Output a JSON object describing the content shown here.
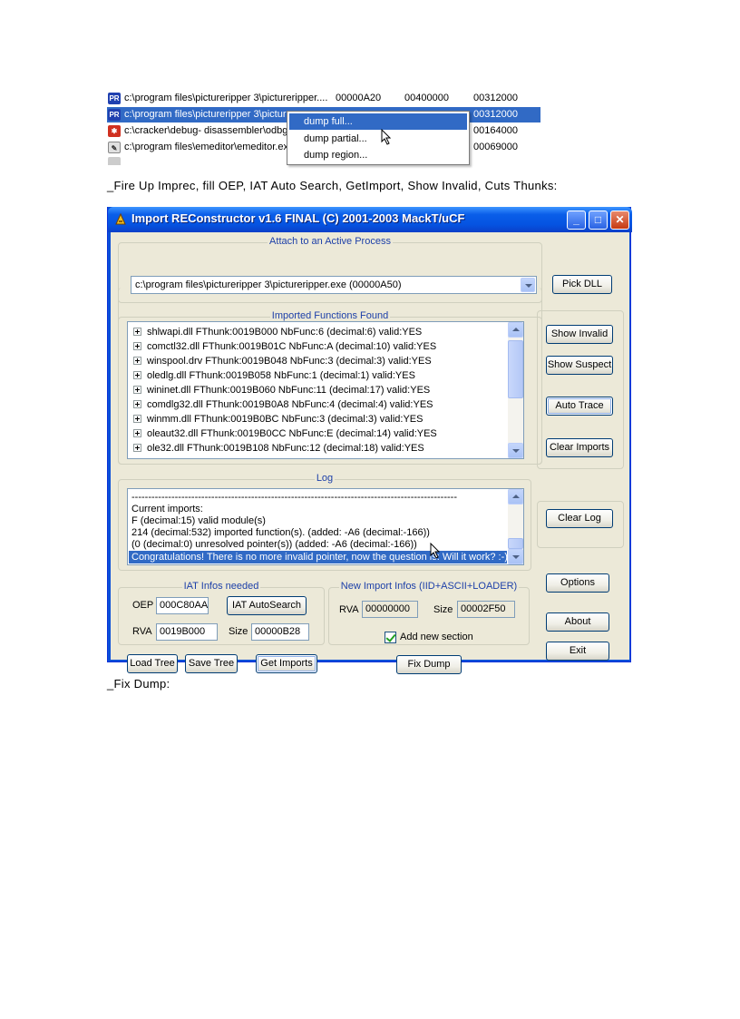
{
  "process_list": {
    "rows": [
      {
        "path": "c:\\program files\\pictureripper 3\\pictureripper....",
        "c1": "00000A20",
        "c2": "00400000",
        "c3": "00312000"
      },
      {
        "path": "c:\\program files\\pictureripper 3\\picture",
        "c1": "",
        "c2": "",
        "c3": "00312000"
      },
      {
        "path": "c:\\cracker\\debug- disassembler\\odbg",
        "c1": "",
        "c2": "",
        "c3": "00164000"
      },
      {
        "path": "c:\\program files\\emeditor\\emeditor.ex",
        "c1": "",
        "c2": "",
        "c3": "00069000"
      }
    ],
    "context_menu": [
      "dump full...",
      "dump partial...",
      "dump region..."
    ]
  },
  "caption_1": "_Fire Up Imprec, fill OEP, IAT Auto Search, GetImport, Show Invalid, Cuts Thunks:",
  "caption_2": "_Fix Dump:",
  "window": {
    "title": "Import REConstructor v1.6 FINAL (C) 2001-2003 MackT/uCF",
    "attach": {
      "group_title": "Attach to an Active Process",
      "process_value": "c:\\program files\\pictureripper 3\\pictureripper.exe (00000A50)",
      "pick_dll_label": "Pick DLL"
    },
    "imports": {
      "group_title": "Imported Functions Found",
      "items": [
        "shlwapi.dll FThunk:0019B000 NbFunc:6 (decimal:6) valid:YES",
        "comctl32.dll FThunk:0019B01C NbFunc:A (decimal:10) valid:YES",
        "winspool.drv FThunk:0019B048 NbFunc:3 (decimal:3) valid:YES",
        "oledlg.dll FThunk:0019B058 NbFunc:1 (decimal:1) valid:YES",
        "wininet.dll FThunk:0019B060 NbFunc:11 (decimal:17) valid:YES",
        "comdlg32.dll FThunk:0019B0A8 NbFunc:4 (decimal:4) valid:YES",
        "winmm.dll FThunk:0019B0BC NbFunc:3 (decimal:3) valid:YES",
        "oleaut32.dll FThunk:0019B0CC NbFunc:E (decimal:14) valid:YES",
        "ole32.dll FThunk:0019B108 NbFunc:12 (decimal:18) valid:YES"
      ]
    },
    "side_buttons": {
      "show_invalid": "Show Invalid",
      "show_suspect": "Show Suspect",
      "auto_trace": "Auto Trace",
      "clear_imports": "Clear Imports",
      "clear_log": "Clear Log",
      "options": "Options",
      "about": "About",
      "exit": "Exit"
    },
    "log": {
      "group_title": "Log",
      "lines": [
        "--------------------------------------------------------------------------------------------------",
        "Current imports:",
        "F (decimal:15) valid module(s)",
        "214 (decimal:532) imported function(s). (added: -A6 (decimal:-166))",
        "(0 (decimal:0) unresolved pointer(s)) (added: -A6 (decimal:-166))",
        "Congratulations! There is no more invalid pointer, now the question is: Will it work? :-)"
      ]
    },
    "iat": {
      "group_title": "IAT Infos needed",
      "oep_label": "OEP",
      "oep_value": "000C80AA",
      "autosearch_label": "IAT AutoSearch",
      "rva_label": "RVA",
      "rva_value": "0019B000",
      "size_label": "Size",
      "size_value": "00000B28"
    },
    "new_import": {
      "group_title": "New Import Infos (IID+ASCII+LOADER)",
      "rva_label": "RVA",
      "rva_value": "00000000",
      "size_label": "Size",
      "size_value": "00002F50",
      "add_section_label": "Add new section",
      "add_section_checked": true
    },
    "bottom_buttons": {
      "load_tree": "Load Tree",
      "save_tree": "Save Tree",
      "get_imports": "Get Imports",
      "fix_dump": "Fix Dump"
    }
  }
}
